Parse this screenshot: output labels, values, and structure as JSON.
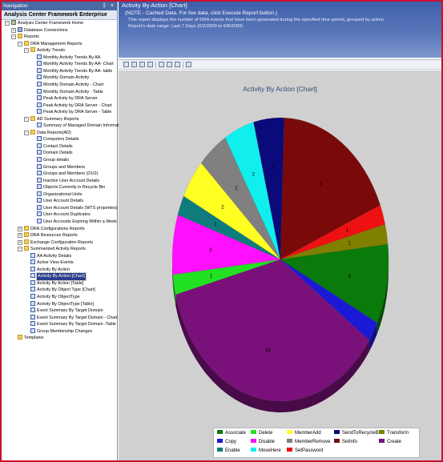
{
  "nav": {
    "titlebar": "Navigation",
    "controls": "‡ ×",
    "header": "Analysis Center Framework Enterprise",
    "tree": [
      {
        "label": "Analysis Center Framework Home",
        "level": 0,
        "expander": "−",
        "icon": "server"
      },
      {
        "label": "Database Connections",
        "level": 1,
        "expander": "+",
        "icon": "db"
      },
      {
        "label": "Reports",
        "level": 1,
        "expander": "−",
        "icon": "folder"
      },
      {
        "label": "DRA Management Reports",
        "level": 2,
        "expander": "−",
        "icon": "folder"
      },
      {
        "label": "Activity Trends",
        "level": 3,
        "expander": "−",
        "icon": "folder"
      },
      {
        "label": "Monthly Activity Trends By AA",
        "level": 4,
        "icon": "report"
      },
      {
        "label": "Monthly Activity Trends By AA- Chart",
        "level": 4,
        "icon": "report"
      },
      {
        "label": "Monthly Activity Trends By AA- table",
        "level": 4,
        "icon": "report"
      },
      {
        "label": "Monthly Domain Activity",
        "level": 4,
        "icon": "report"
      },
      {
        "label": "Monthly Domain Activity - Chart",
        "level": 4,
        "icon": "report"
      },
      {
        "label": "Monthly Domain Activity - Table",
        "level": 4,
        "icon": "report"
      },
      {
        "label": "Peak Activity by DRA Server",
        "level": 4,
        "icon": "report"
      },
      {
        "label": "Peak Activity by DRA Server - Chart",
        "level": 4,
        "icon": "report"
      },
      {
        "label": "Peak Activity by DRA Server - Table",
        "level": 4,
        "icon": "report"
      },
      {
        "label": "AD Summary Reports",
        "level": 3,
        "expander": "−",
        "icon": "folder"
      },
      {
        "label": "Summary of Managed Domain Information",
        "level": 4,
        "icon": "report"
      },
      {
        "label": "Data Reports(AD)",
        "level": 3,
        "expander": "−",
        "icon": "folder"
      },
      {
        "label": "Computers Details",
        "level": 4,
        "icon": "report"
      },
      {
        "label": "Contact Details",
        "level": 4,
        "icon": "report"
      },
      {
        "label": "Domain Details",
        "level": 4,
        "icon": "report"
      },
      {
        "label": "Group details",
        "level": 4,
        "icon": "report"
      },
      {
        "label": "Groups and Members",
        "level": 4,
        "icon": "report"
      },
      {
        "label": "Groups and Members (OU2)",
        "level": 4,
        "icon": "report"
      },
      {
        "label": "Inactive User Account Details",
        "level": 4,
        "icon": "report"
      },
      {
        "label": "Objects Currently in Recycle Bin",
        "level": 4,
        "icon": "report"
      },
      {
        "label": "Organizational Units",
        "level": 4,
        "icon": "report"
      },
      {
        "label": "User Account Details",
        "level": 4,
        "icon": "report"
      },
      {
        "label": "User Account Details (WTS properties)",
        "level": 4,
        "icon": "report"
      },
      {
        "label": "User Account Duplicates",
        "level": 4,
        "icon": "report"
      },
      {
        "label": "User Accounts Expiring Within a Week",
        "level": 4,
        "icon": "report"
      },
      {
        "label": "DRA Configurations Reports",
        "level": 2,
        "expander": "+",
        "icon": "folder"
      },
      {
        "label": "DRA Resources Reports",
        "level": 2,
        "expander": "+",
        "icon": "folder"
      },
      {
        "label": "Exchange Configuration Reports",
        "level": 2,
        "expander": "+",
        "icon": "folder"
      },
      {
        "label": "Summarized Activity Reports",
        "level": 2,
        "expander": "−",
        "icon": "folder"
      },
      {
        "label": "AA Activity Details",
        "level": 3,
        "icon": "report"
      },
      {
        "label": "Active View Events",
        "level": 3,
        "icon": "report"
      },
      {
        "label": "Activity By Action",
        "level": 3,
        "icon": "report"
      },
      {
        "label": "Activity By Action [Chart]",
        "level": 3,
        "icon": "report",
        "selected": true
      },
      {
        "label": "Activity By Action [Table]",
        "level": 3,
        "icon": "report"
      },
      {
        "label": "Activity By Object Type [Chart]",
        "level": 3,
        "icon": "report"
      },
      {
        "label": "Activity By ObjectType",
        "level": 3,
        "icon": "report"
      },
      {
        "label": "Activity By ObjectType [Table]",
        "level": 3,
        "icon": "report"
      },
      {
        "label": "Event Summary By Target Domain",
        "level": 3,
        "icon": "report"
      },
      {
        "label": "Event Summary By Target Domain - Chart",
        "level": 3,
        "icon": "report"
      },
      {
        "label": "Event Summary By Target Domain -Table",
        "level": 3,
        "icon": "report"
      },
      {
        "label": "Group Membership Changes",
        "level": 3,
        "icon": "report"
      },
      {
        "label": "Templates",
        "level": 1,
        "icon": "folder"
      }
    ]
  },
  "report": {
    "title": "Activity By Action [Chart]",
    "note": "(NOTE - Cached Data. For live data, click Execute Report button.)",
    "description": "This report displays the number of DRA events that have been generated during the specified time period, grouped by action.",
    "date_range": "Report's date range:  Last  7 Days (6/2/2009 to 6/8/2009)"
  },
  "toolbar": {
    "icons": [
      "copy-icon",
      "print-icon",
      "export-icon",
      "refresh-icon",
      "chart-type-icon",
      "bulb-icon",
      "settings-icon",
      "execute-icon"
    ]
  },
  "chart_data": {
    "type": "pie",
    "title": "Activity By Action [Chart]",
    "legend_position": "bottom",
    "slices": [
      {
        "name": "SetInfo",
        "value": 8,
        "label": "8",
        "color": "#7a0a0a"
      },
      {
        "name": "SetPassword",
        "value": 1,
        "label": "1",
        "color": "#ee1111"
      },
      {
        "name": "Transform",
        "value": 1,
        "label": "1",
        "color": "#808000"
      },
      {
        "name": "Associate",
        "value": 4,
        "label": "4",
        "color": "#0a7a0a"
      },
      {
        "name": "Copy",
        "value": 1,
        "label": "",
        "color": "#1a1ad6"
      },
      {
        "name": "Create",
        "value": 16,
        "label": "16",
        "color": "#7a117a"
      },
      {
        "name": "Delete",
        "value": 1,
        "label": "1",
        "color": "#22e022"
      },
      {
        "name": "Disable",
        "value": 3,
        "label": "3",
        "color": "#ff10ff"
      },
      {
        "name": "Enable",
        "value": 1,
        "label": "1",
        "color": "#0f7c7c"
      },
      {
        "name": "MemberAdd",
        "value": 2,
        "label": "2",
        "color": "#ffff22"
      },
      {
        "name": "MemberRemove",
        "value": 2,
        "label": "2",
        "color": "#808080"
      },
      {
        "name": "MoveHere",
        "value": 2,
        "label": "2",
        "color": "#11eeee"
      },
      {
        "name": "SendToRecycleBin",
        "value": 2,
        "label": "2",
        "color": "#0a0a7a"
      }
    ]
  },
  "legend": [
    {
      "name": "Associate",
      "color": "#0a7a0a"
    },
    {
      "name": "Delete",
      "color": "#22e022"
    },
    {
      "name": "MemberAdd",
      "color": "#ffff22"
    },
    {
      "name": "SendToRecycleBin",
      "color": "#0a0a7a"
    },
    {
      "name": "Transform",
      "color": "#808000"
    },
    {
      "name": "Copy",
      "color": "#1a1ad6"
    },
    {
      "name": "Disable",
      "color": "#ff10ff"
    },
    {
      "name": "MemberRemove",
      "color": "#808080"
    },
    {
      "name": "SetInfo",
      "color": "#7a0a0a"
    },
    {
      "name": "Create",
      "color": "#7a117a"
    },
    {
      "name": "Enable",
      "color": "#0f7c7c"
    },
    {
      "name": "MoveHere",
      "color": "#11eeee"
    },
    {
      "name": "SetPassword",
      "color": "#ee1111"
    }
  ]
}
